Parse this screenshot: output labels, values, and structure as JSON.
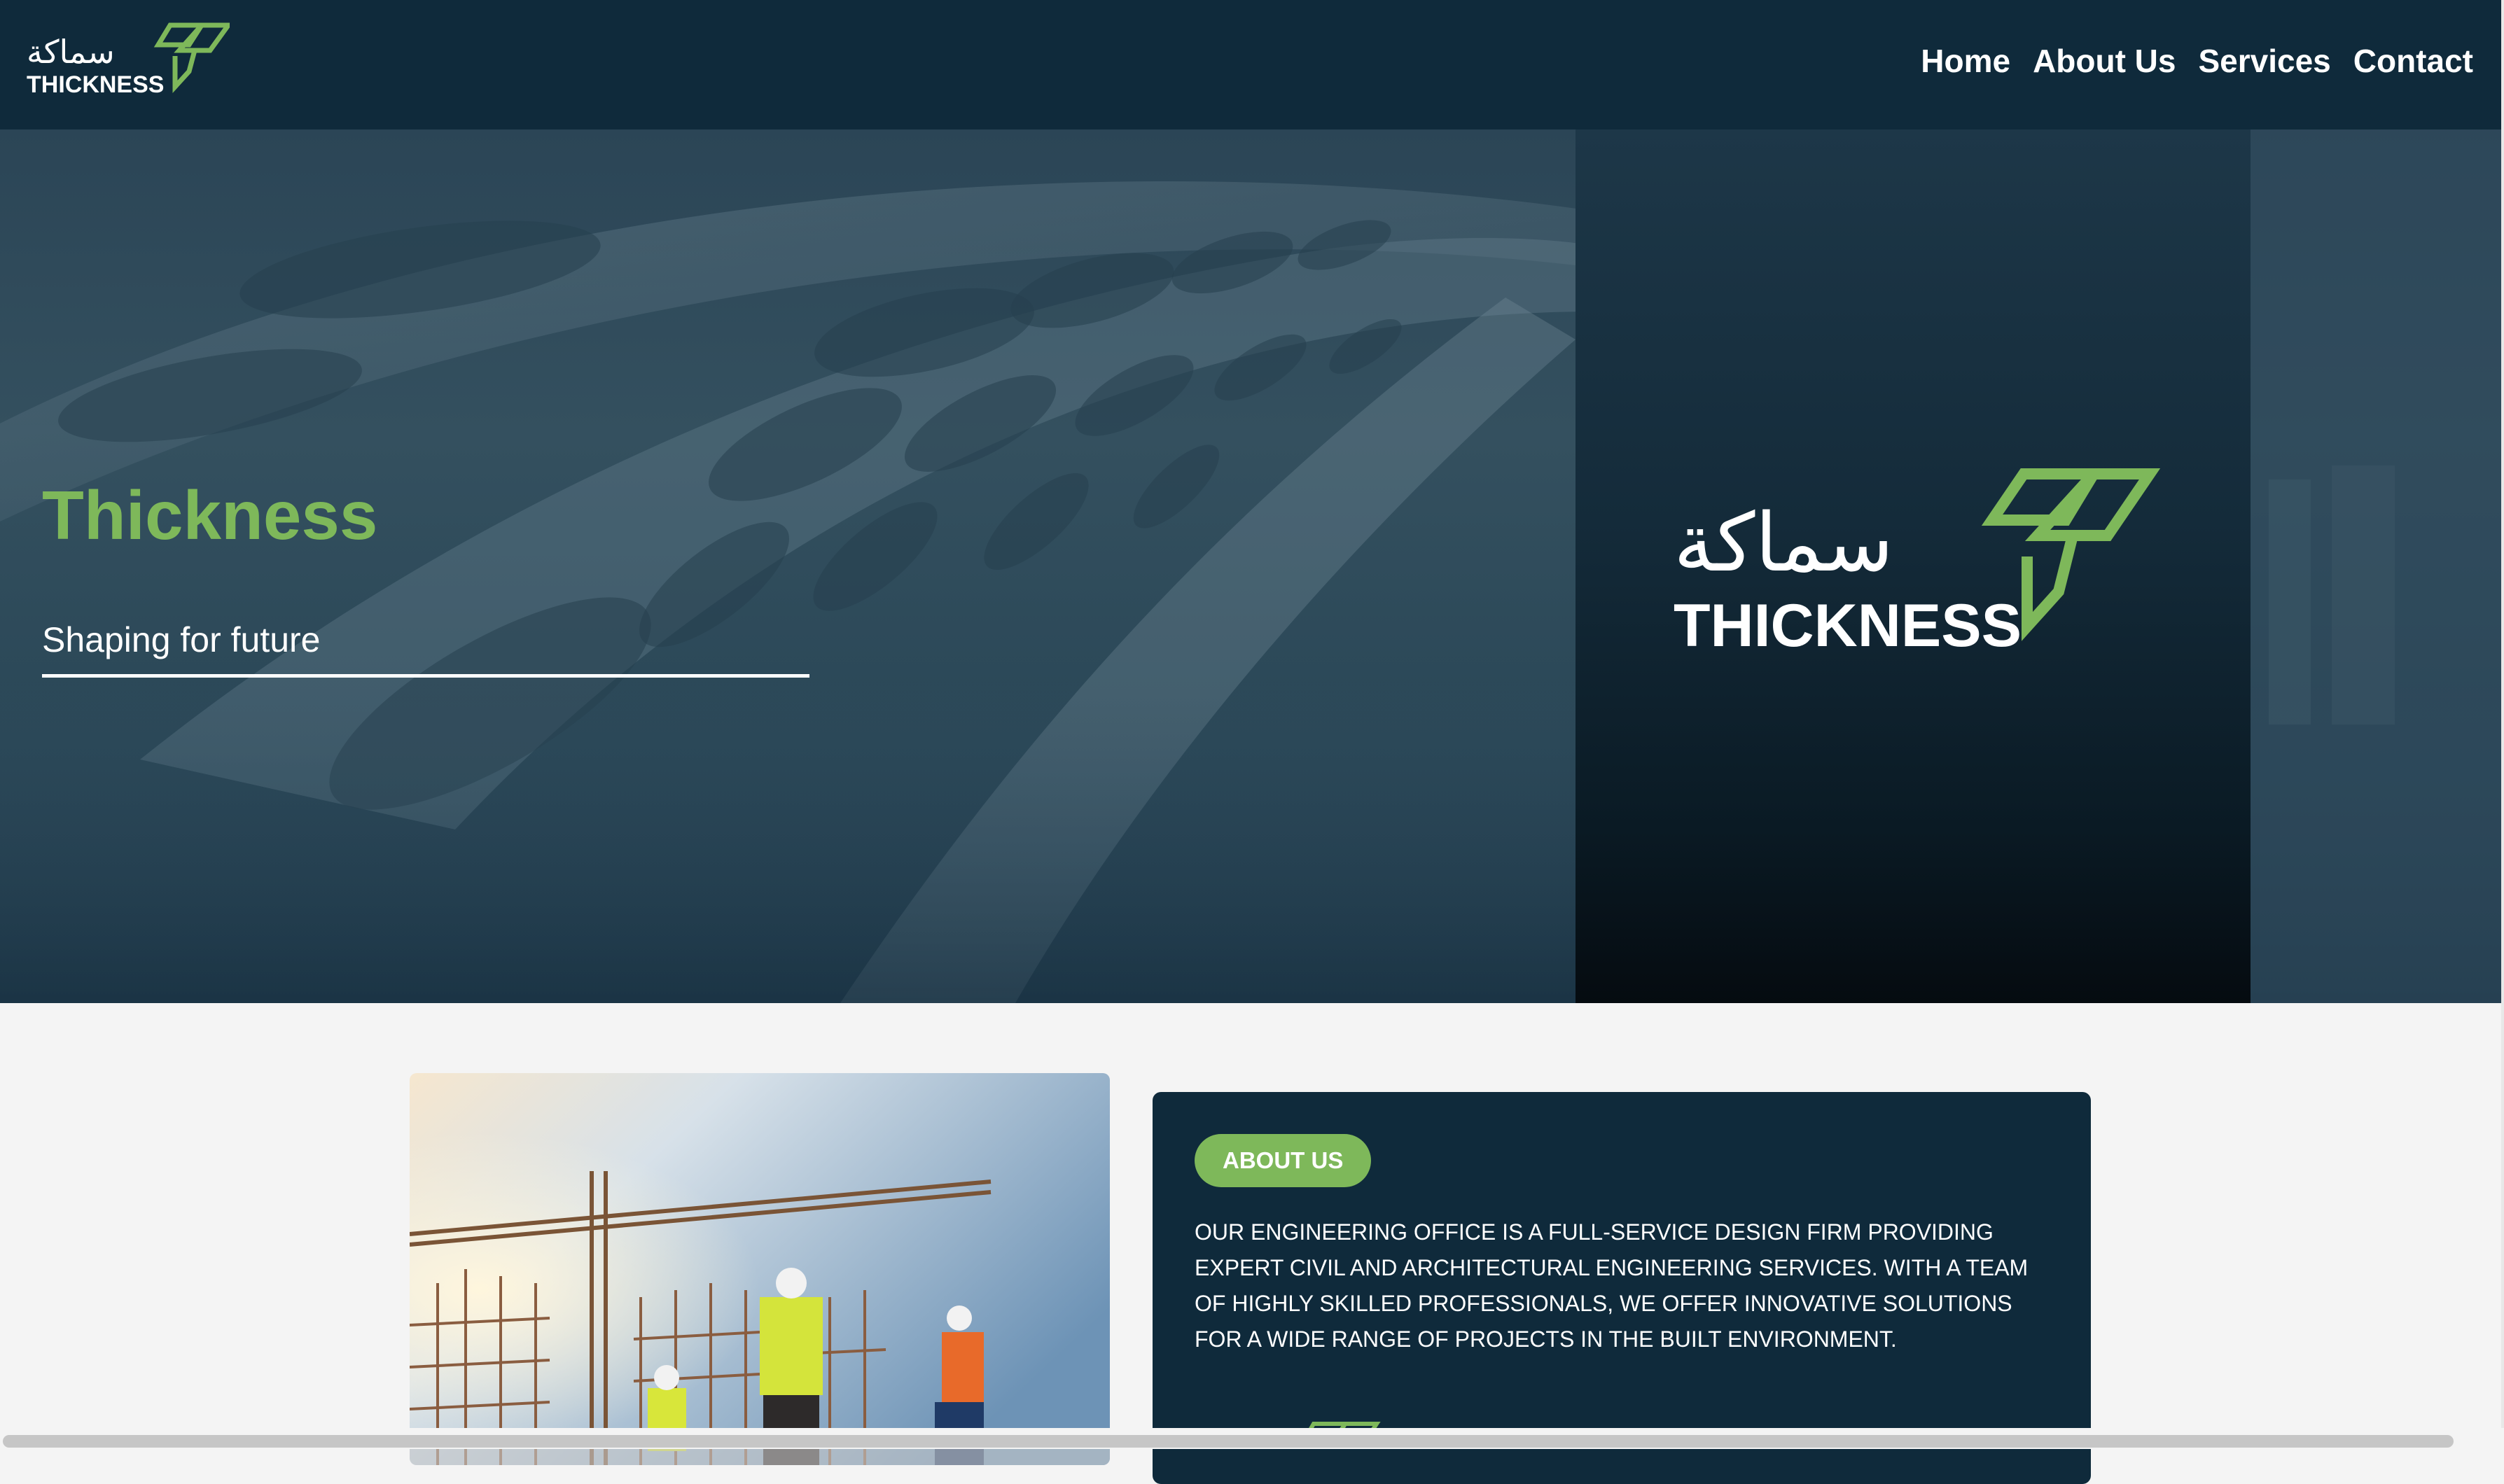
{
  "brand": {
    "name": "THICKNESS",
    "arabic_name": "سماكة",
    "logo_icon": "thickness-logo-icon",
    "accent_color": "#7eb85a",
    "nav_color": "#0f2a3b"
  },
  "nav": {
    "items": [
      {
        "label": "Home"
      },
      {
        "label": "About Us"
      },
      {
        "label": "Services"
      },
      {
        "label": "Contact"
      }
    ]
  },
  "hero": {
    "title": "Thickness",
    "subtitle": "Shaping for future"
  },
  "about": {
    "badge": "ABOUT US",
    "text": "OUR ENGINEERING OFFICE IS A FULL-SERVICE DESIGN FIRM PROVIDING EXPERT CIVIL AND ARCHITECTURAL ENGINEERING SERVICES. WITH A TEAM OF HIGHLY SKILLED PROFESSIONALS, WE OFFER INNOVATIVE SOLUTIONS FOR A WIDE RANGE OF PROJECTS IN THE BUILT ENVIRONMENT."
  }
}
